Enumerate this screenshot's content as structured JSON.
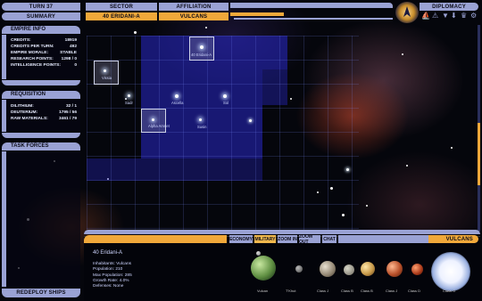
{
  "header": {
    "turn": "TURN 37",
    "summary": "SUMMARY",
    "sector_label": "SECTOR",
    "sector_value": "40 ERIDANI-A",
    "affiliation_label": "AFFILIATION",
    "affiliation_value": "VULCANS",
    "diplomacy": "DIPLOMACY"
  },
  "empire_info": {
    "title": "EMPIRE INFO",
    "rows": [
      {
        "label": "CREDITS:",
        "value": "18919"
      },
      {
        "label": "CREDITS PER TURN:",
        "value": "492"
      },
      {
        "label": "EMPIRE MORALE:",
        "value": "STABLE"
      },
      {
        "label": "RESEARCH POINTS:",
        "value": "1298 / 0"
      },
      {
        "label": "INTELLIGENCE POINTS:",
        "value": "0"
      }
    ]
  },
  "requisition": {
    "title": "REQUISITION",
    "rows": [
      {
        "label": "DILITHIUM:",
        "value": "32 / 1"
      },
      {
        "label": "DEUTERIUM:",
        "value": "1795 / 56"
      },
      {
        "label": "RAW MATERIALS:",
        "value": "3461 / 79"
      }
    ]
  },
  "task_forces": {
    "title": "TASK FORCES"
  },
  "redeploy": "REDEPLOY SHIPS",
  "map": {
    "systems": [
      {
        "name": "40 Eridani-A"
      },
      {
        "name": "Vissia"
      },
      {
        "name": "Sadr"
      },
      {
        "name": "Ascella"
      },
      {
        "name": "Sol"
      },
      {
        "name": "Alpha Amnet"
      },
      {
        "name": "Susin"
      }
    ]
  },
  "bottom_tabs": [
    "ECONOMY",
    "MILITARY",
    "ZOOM IN",
    "ZOOM OUT",
    "CHAT"
  ],
  "bottom_faction": "VULCANS",
  "system_info": {
    "name": "40 Eridani-A",
    "lines": [
      "Inhabitants: Vulcans",
      "Population: 210",
      "Max Population: 285",
      "Growth Rate: 4.0%",
      "Defenses: None"
    ]
  },
  "planet_labels": [
    "Vulcan",
    "T'Khut",
    "Class J",
    "Class B",
    "Class B",
    "Class J",
    "Class D",
    "Class O"
  ],
  "colors": {
    "lcars_blue": "#9aa2d4",
    "lcars_orange": "#f0a83a",
    "territory": "#2828c8"
  },
  "icons": [
    "federation-emblem-icon",
    "ship-icon",
    "alert-icon",
    "bookmark-icon",
    "down-arrow-icon",
    "trophy-icon",
    "settings-icon"
  ]
}
